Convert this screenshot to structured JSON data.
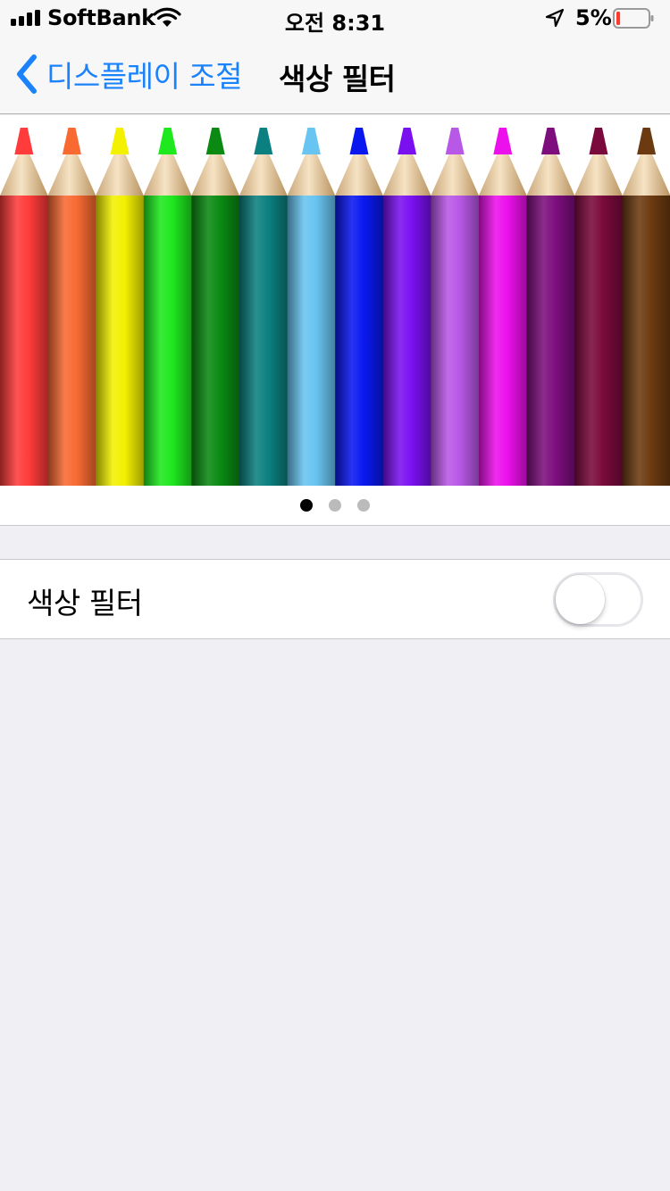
{
  "status_bar": {
    "carrier": "SoftBank",
    "time": "오전 8:31",
    "battery_percent": "5%",
    "battery_level": 0.05,
    "battery_color": "#ff3b30",
    "signal_bars": 4,
    "icons": [
      "signal-bars-icon",
      "wifi-icon",
      "location-arrow-icon",
      "battery-icon"
    ]
  },
  "nav": {
    "back_label": "디스플레이 조절",
    "title": "색상 필터",
    "accent_color": "#1a82fb"
  },
  "preview": {
    "pencil_colors": [
      "#ff3b3b",
      "#f86a32",
      "#f3f000",
      "#1ee81e",
      "#0a8a12",
      "#0c8080",
      "#68c4f0",
      "#0a18f0",
      "#7a10f0",
      "#b858e6",
      "#ec10ec",
      "#7e0e7e",
      "#7a0a3c",
      "#6c3a10"
    ],
    "pages": 3,
    "current_page": 1
  },
  "settings": {
    "color_filter_label": "색상 필터",
    "color_filter_on": false
  }
}
